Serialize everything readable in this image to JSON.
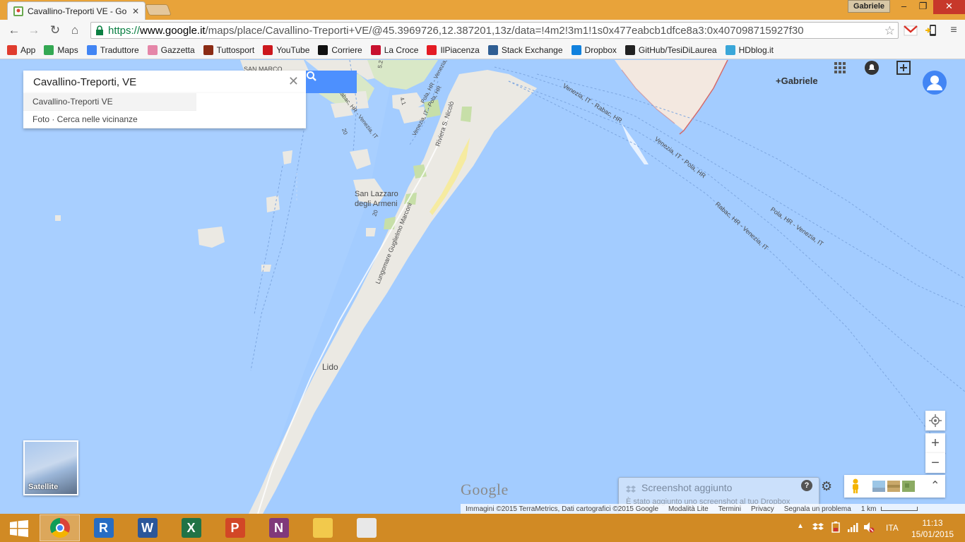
{
  "browser": {
    "tab_title": "Cavallino-Treporti VE - Go",
    "profile_name": "Gabriele",
    "url_scheme": "https://",
    "url_host": "www.google.it",
    "url_path": "/maps/place/Cavallino-Treporti+VE/@45.3969726,12.387201,13z/data=!4m2!3m1!1s0x477eabcb1dfce8a3:0x407098715927f30"
  },
  "bookmarks": [
    {
      "label": "App",
      "icon": "apps-grid-icon",
      "color": "#e03c2e"
    },
    {
      "label": "Maps",
      "icon": "maps-icon",
      "color": "#34a853"
    },
    {
      "label": "Traduttore",
      "icon": "translate-icon",
      "color": "#4285f4"
    },
    {
      "label": "Gazzetta",
      "icon": "gazzetta-icon",
      "color": "#e586a8"
    },
    {
      "label": "Tuttosport",
      "icon": "tuttosport-icon",
      "color": "#8b2b14"
    },
    {
      "label": "YouTube",
      "icon": "youtube-icon",
      "color": "#cc181e"
    },
    {
      "label": "Corriere",
      "icon": "corriere-icon",
      "color": "#111111"
    },
    {
      "label": "La Croce",
      "icon": "lacroce-icon",
      "color": "#c8102e"
    },
    {
      "label": "IlPiacenza",
      "icon": "ilpiacenza-icon",
      "color": "#e41b23"
    },
    {
      "label": "Stack Exchange",
      "icon": "stackexchange-icon",
      "color": "#2f5e93"
    },
    {
      "label": "Dropbox",
      "icon": "dropbox-icon",
      "color": "#1081de"
    },
    {
      "label": "GitHub/TesiDiLaurea",
      "icon": "github-icon",
      "color": "#222222"
    },
    {
      "label": "HDblog.it",
      "icon": "hdblog-icon",
      "color": "#3aa7d9"
    }
  ],
  "maps": {
    "search_value": "Cavallino-Treporti, VE",
    "suggestions": [
      "Cavallino-Treporti VE",
      "Foto · Cerca nelle vicinanze"
    ],
    "account_name": "+Gabriele",
    "satellite_label": "Satellite",
    "logo": "Google",
    "labels": {
      "san_marco": "SAN MARCO",
      "san_lazzaro": "San Lazzaro",
      "degli_armeni": "degli Armeni",
      "lido": "Lido",
      "lungomare": "Lungomare Guglielmo Marconi",
      "riviera": "Riviera S. Nicolò",
      "route1": "Venezia, IT - Rabac, HR",
      "route2": "Venezia, IT - Pola, HR",
      "route3": "Rabac, HR - Venezia, IT",
      "route4": "Pola, HR - Venezia, IT",
      "route5": "Venezia, IT - Pola, HR",
      "route6": "Pola, HR - Venezia, IT",
      "route7": "Rabac, HR - Venezia, IT",
      "num20a": "20",
      "num20b": "20",
      "num41": "4.1",
      "num52": "5.2"
    },
    "attribution": {
      "imagery": "Immagini ©2015 TerraMetrics, Dati cartografici ©2015 Google",
      "lite": "Modalità Lite",
      "terms": "Termini",
      "privacy": "Privacy",
      "report": "Segnala un problema",
      "scale": "1 km"
    },
    "toast": {
      "title": "Screenshot aggiunto",
      "message": "È stato aggiunto uno screenshot al tuo Dropbox"
    }
  },
  "taskbar": {
    "apps": [
      {
        "name": "chrome",
        "letter": "",
        "color": "#4285f4",
        "active": true
      },
      {
        "name": "r",
        "letter": "R",
        "color": "#276dc3",
        "active": false
      },
      {
        "name": "word",
        "letter": "W",
        "color": "#2b579a",
        "active": false
      },
      {
        "name": "excel",
        "letter": "X",
        "color": "#217346",
        "active": false
      },
      {
        "name": "powerpoint",
        "letter": "P",
        "color": "#d24726",
        "active": false
      },
      {
        "name": "onenote",
        "letter": "N",
        "color": "#80397b",
        "active": false
      },
      {
        "name": "explorer",
        "letter": "",
        "color": "#f2c94c",
        "active": false
      },
      {
        "name": "snipping",
        "letter": "",
        "color": "#e8e8e8",
        "active": false
      }
    ],
    "language": "ITA",
    "time": "11:13",
    "date": "15/01/2015"
  }
}
